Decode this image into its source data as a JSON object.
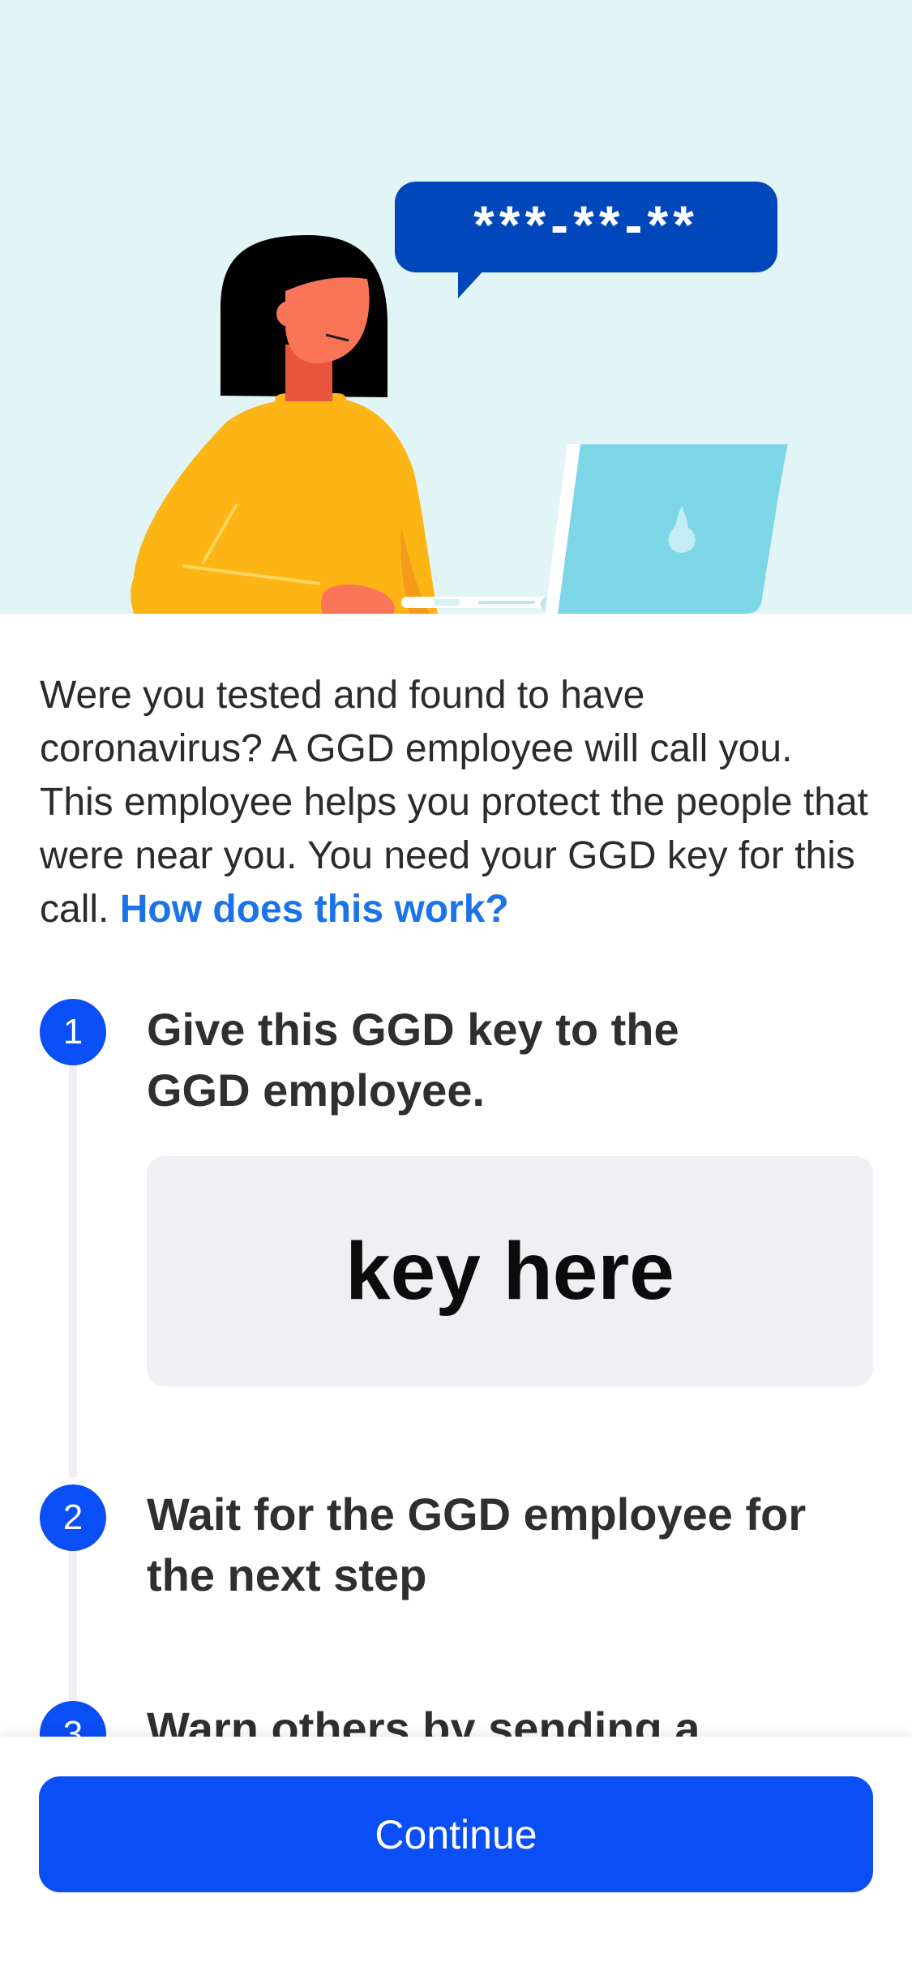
{
  "hero": {
    "speech_bubble_text": "***-**-**"
  },
  "intro": {
    "text": "Were you tested and found to have coronavirus? A GGD employee will call you. This employee helps you protect the people that were near you. You need your GGD key for this call. ",
    "link_label": "How does this work?"
  },
  "steps": [
    {
      "number": "1",
      "title": "Give this GGD key to the GGD employee."
    },
    {
      "number": "2",
      "title": "Wait for the GGD employee for the next step"
    },
    {
      "number": "3",
      "title": "Warn others by sending a"
    }
  ],
  "key_box": {
    "value": "key here"
  },
  "footer": {
    "continue_label": "Continue"
  },
  "colors": {
    "hero_background": "#e1f5f7",
    "primary_button": "#0a4ef5",
    "link": "#1a73e8",
    "speech_bubble": "#0047bb",
    "laptop": "#7dd6e6",
    "sweater": "#fdb515",
    "skin": "#fa7557"
  }
}
